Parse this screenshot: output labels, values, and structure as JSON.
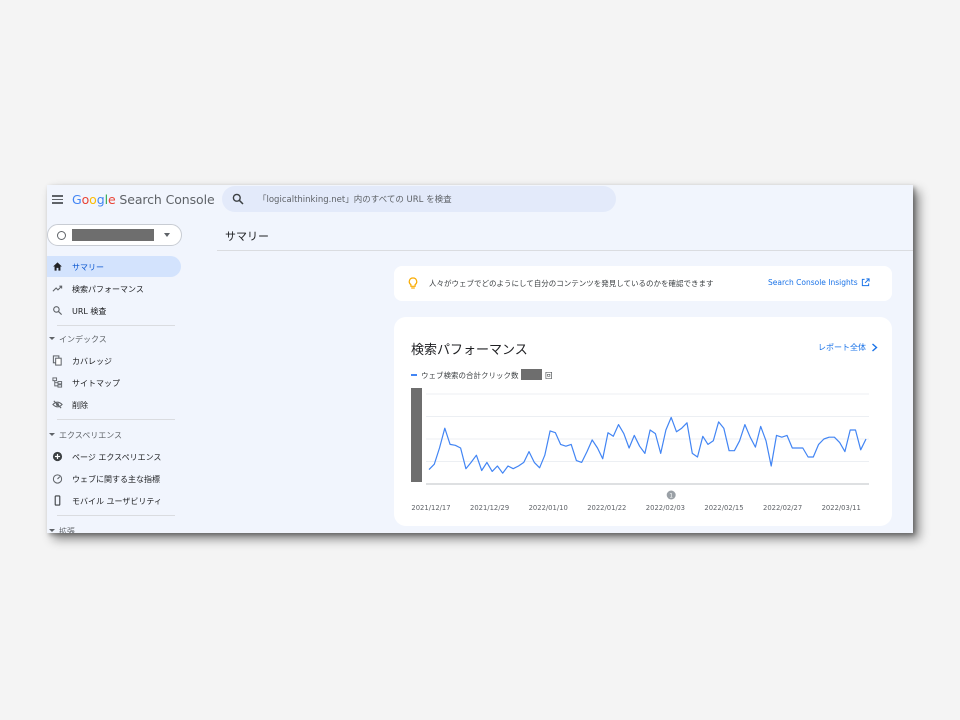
{
  "header": {
    "menu_icon": "hamburger-menu-icon",
    "logo": {
      "google": [
        "G",
        "o",
        "o",
        "g",
        "l",
        "e"
      ],
      "product": " Search Console"
    },
    "search": {
      "icon": "search-icon",
      "placeholder": "「logicalthinking.net」内のすべての URL を検査"
    }
  },
  "sidebar": {
    "property_icon": "globe-icon",
    "property_caret": "caret-down-icon",
    "items": [
      {
        "label": "サマリー",
        "icon": "home-icon",
        "active": true
      },
      {
        "label": "検索パフォーマンス",
        "icon": "trending-up-icon"
      },
      {
        "label": "URL 検査",
        "icon": "search-icon"
      }
    ],
    "sections": [
      {
        "label": "インデックス",
        "items": [
          {
            "label": "カバレッジ",
            "icon": "file-copy-icon"
          },
          {
            "label": "サイトマップ",
            "icon": "sitemap-icon"
          },
          {
            "label": "削除",
            "icon": "visibility-off-icon"
          }
        ]
      },
      {
        "label": "エクスペリエンス",
        "items": [
          {
            "label": "ページ エクスペリエンス",
            "icon": "add-circle-icon"
          },
          {
            "label": "ウェブに関する主な指標",
            "icon": "speed-gauge-icon"
          },
          {
            "label": "モバイル ユーザビリティ",
            "icon": "smartphone-icon"
          }
        ]
      },
      {
        "label": "拡張",
        "items": []
      }
    ]
  },
  "main": {
    "page_title": "サマリー",
    "insight": {
      "icon": "lightbulb-icon",
      "text": "人々がウェブでどのようにして自分のコンテンツを発見しているのかを確認できます",
      "link": "Search Console Insights",
      "link_icon": "open-in-new-icon"
    },
    "performance": {
      "title": "検索パフォーマンス",
      "report_link": "レポート全体",
      "report_icon": "chevron-right-icon",
      "legend_label": "ウェブ検索の合計クリック数",
      "legend_unit": "回",
      "annotation_label": "1"
    }
  },
  "colors": {
    "accent": "#1a73e8",
    "line": "#4285f4",
    "active_nav": "#d3e3fd",
    "background": "#f1f5fd",
    "redaction": "#6e6e6e"
  },
  "chart_data": {
    "type": "line",
    "x_tick_labels": [
      "2021/12/17",
      "2021/12/29",
      "2022/01/10",
      "2022/01/22",
      "2022/02/03",
      "2022/02/15",
      "2022/02/27",
      "2022/03/11"
    ],
    "y_tick_labels_visible": false,
    "ylim": [
      0,
      100
    ],
    "grid": true,
    "series": [
      {
        "name": "ウェブ検索の合計クリック数",
        "values": [
          16,
          22,
          40,
          62,
          44,
          43,
          40,
          17,
          24,
          32,
          15,
          24,
          14,
          20,
          12,
          20,
          17,
          20,
          24,
          36,
          24,
          18,
          32,
          59,
          57,
          44,
          42,
          44,
          26,
          24,
          36,
          49,
          40,
          28,
          57,
          53,
          66,
          56,
          40,
          54,
          42,
          34,
          60,
          56,
          34,
          60,
          74,
          58,
          62,
          68,
          34,
          30,
          53,
          44,
          48,
          69,
          62,
          37,
          37,
          48,
          66,
          52,
          41,
          64,
          48,
          20,
          54,
          52,
          54,
          40,
          40,
          40,
          30,
          30,
          44,
          50,
          52,
          52,
          46,
          36,
          60,
          60,
          38,
          50
        ],
        "annotation_index": 46
      }
    ]
  }
}
